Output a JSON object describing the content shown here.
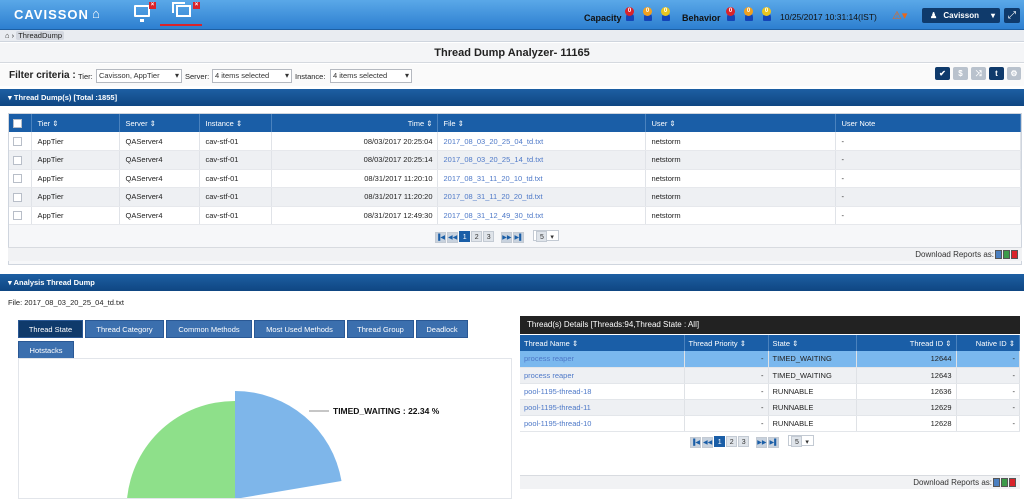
{
  "topbar": {
    "logo": "CAVISSON",
    "capacity_label": "Capacity",
    "behavior_label": "Behavior",
    "capacity_counts": [
      "0",
      "0",
      "0"
    ],
    "behavior_counts": [
      "0",
      "0",
      "0"
    ],
    "datetime": "10/25/2017 10:31:14(IST)",
    "user": "Cavisson",
    "colors": {
      "critical": "#d9232a",
      "major": "#f0a020",
      "minor": "#e8c520"
    }
  },
  "breadcrumb": {
    "home_icon": "home-icon",
    "current": "ThreadDump"
  },
  "page": {
    "title": "Thread Dump Analyzer- 11165"
  },
  "filter": {
    "label": "Filter criteria :",
    "tier_label": "Tier:",
    "tier_value": "Cavisson, AppTier",
    "server_label": "Server:",
    "server_value": "4 items selected",
    "instance_label": "Instance:",
    "instance_value": "4 items selected"
  },
  "dump_section": {
    "title": "Thread Dump(s) [Total :1855]",
    "columns": [
      "Tier",
      "Server",
      "Instance",
      "Time",
      "File",
      "User",
      "User Note"
    ],
    "rows": [
      {
        "tier": "AppTier",
        "server": "QAServer4",
        "instance": "cav-stf-01",
        "time": "08/03/2017 20:25:04",
        "file": "2017_08_03_20_25_04_td.txt",
        "user": "netstorm",
        "note": "-"
      },
      {
        "tier": "AppTier",
        "server": "QAServer4",
        "instance": "cav-stf-01",
        "time": "08/03/2017 20:25:14",
        "file": "2017_08_03_20_25_14_td.txt",
        "user": "netstorm",
        "note": "-"
      },
      {
        "tier": "AppTier",
        "server": "QAServer4",
        "instance": "cav-stf-01",
        "time": "08/31/2017 11:20:10",
        "file": "2017_08_31_11_20_10_td.txt",
        "user": "netstorm",
        "note": "-"
      },
      {
        "tier": "AppTier",
        "server": "QAServer4",
        "instance": "cav-stf-01",
        "time": "08/31/2017 11:20:20",
        "file": "2017_08_31_11_20_20_td.txt",
        "user": "netstorm",
        "note": "-"
      },
      {
        "tier": "AppTier",
        "server": "QAServer4",
        "instance": "cav-stf-01",
        "time": "08/31/2017 12:49:30",
        "file": "2017_08_31_12_49_30_td.txt",
        "user": "netstorm",
        "note": "-"
      }
    ],
    "pager": {
      "pages": [
        "1",
        "2",
        "3"
      ],
      "page_size": "5"
    },
    "download_label": "Download Reports as:"
  },
  "analysis_section": {
    "title": "Analysis Thread Dump",
    "file": "File: 2017_08_03_20_25_04_td.txt",
    "tabs": [
      "Thread State",
      "Thread Category",
      "Common Methods",
      "Most Used Methods",
      "Thread Group",
      "Deadlock",
      "Hotstacks"
    ],
    "pie_label": "TIMED_WAITING : 22.34 %"
  },
  "chart_data": {
    "type": "pie",
    "slices": [
      {
        "label": "TIMED_WAITING",
        "value": 22.34,
        "color": "#7eb6ea"
      }
    ]
  },
  "thread_details": {
    "title": "Thread(s) Details [Threads:94,Thread State : All]",
    "columns": [
      "Thread Name",
      "Thread Priority",
      "State",
      "Thread ID",
      "Native ID"
    ],
    "rows": [
      {
        "name": "process reaper",
        "priority": "-",
        "state": "TIMED_WAITING",
        "id": "12644",
        "native": "-"
      },
      {
        "name": "process reaper",
        "priority": "-",
        "state": "TIMED_WAITING",
        "id": "12643",
        "native": "-"
      },
      {
        "name": "pool-1195-thread-18",
        "priority": "-",
        "state": "RUNNABLE",
        "id": "12636",
        "native": "-"
      },
      {
        "name": "pool-1195-thread-11",
        "priority": "-",
        "state": "RUNNABLE",
        "id": "12629",
        "native": "-"
      },
      {
        "name": "pool-1195-thread-10",
        "priority": "-",
        "state": "RUNNABLE",
        "id": "12628",
        "native": "-"
      }
    ],
    "pager": {
      "pages": [
        "1",
        "2",
        "3"
      ],
      "page_size": "5"
    },
    "download_label": "Download Reports as:"
  }
}
